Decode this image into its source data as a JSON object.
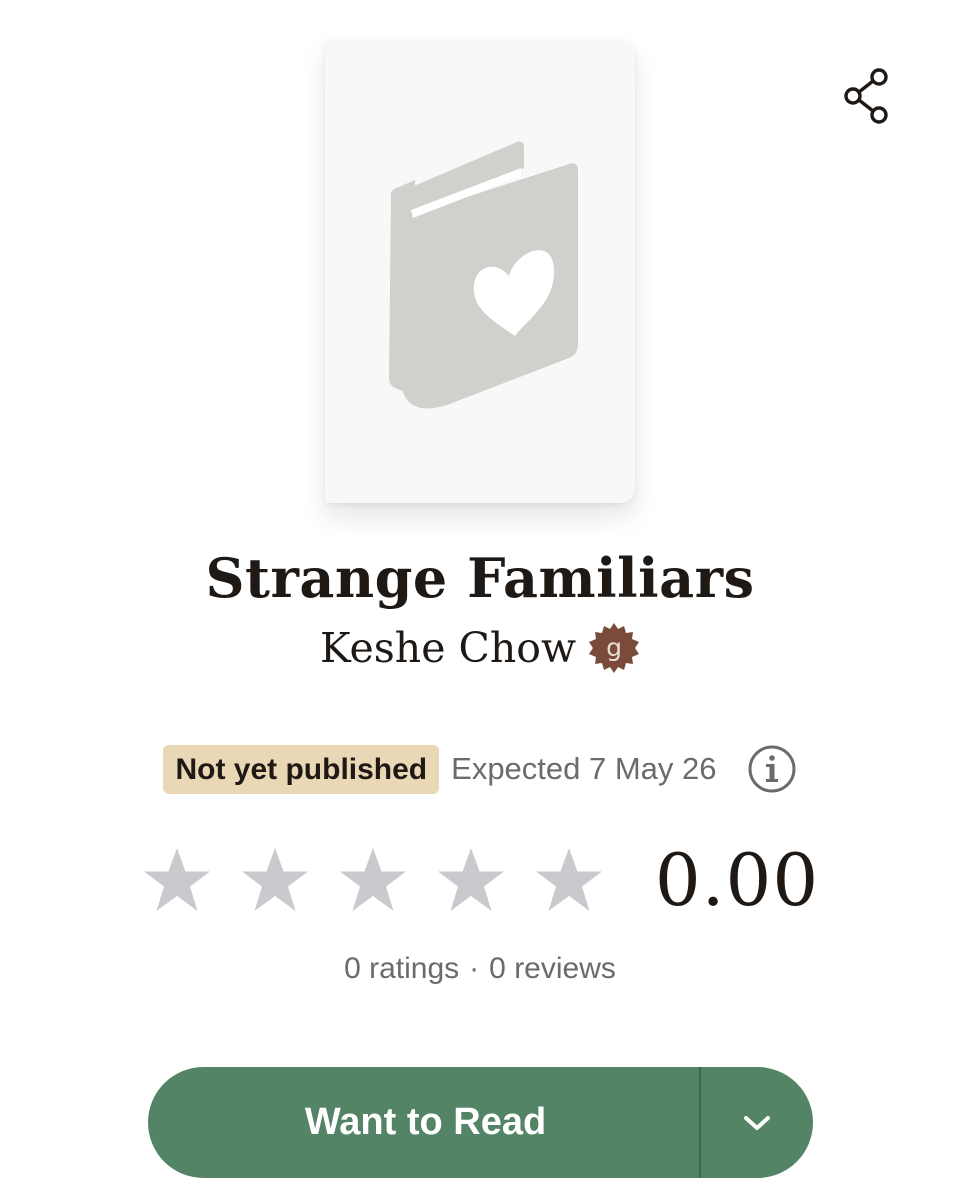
{
  "header": {
    "share_icon": "share-icon"
  },
  "book": {
    "title": "Strange Familiars",
    "author": "Keshe Chow",
    "author_badge_letter": "g",
    "cover_icon": "book-heart-icon"
  },
  "status": {
    "pill": "Not yet published",
    "expected": "Expected 7 May 26",
    "info_icon": "info-icon"
  },
  "rating": {
    "stars_total": 5,
    "stars_filled": 0,
    "average": "0.00",
    "ratings_label": "0 ratings",
    "separator": "·",
    "reviews_label": "0 reviews"
  },
  "shelf": {
    "button_label": "Want to Read",
    "menu_icon": "chevron-down-icon"
  },
  "colors": {
    "accent_green": "#538465",
    "status_pill_bg": "#ead7b5",
    "author_badge": "#7a4a3a",
    "star_empty": "#c9cace"
  }
}
